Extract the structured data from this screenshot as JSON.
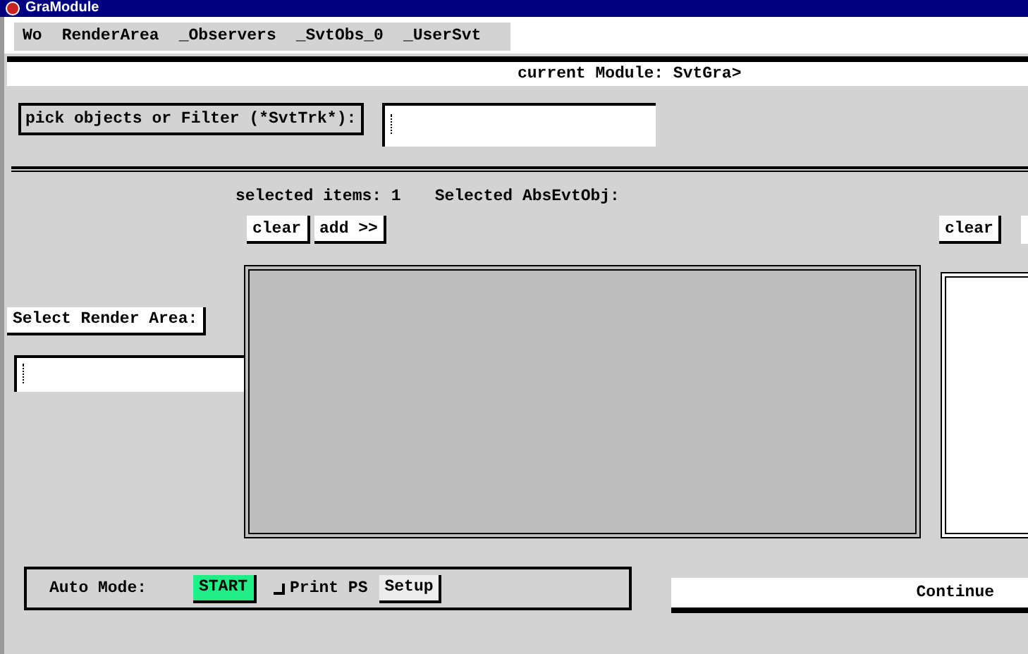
{
  "window": {
    "title": "GraModule"
  },
  "menu": [
    {
      "label": "Wo"
    },
    {
      "label": "RenderArea"
    },
    {
      "label": "_Observers"
    },
    {
      "label": "_SvtObs_0"
    },
    {
      "label": "_UserSvt"
    }
  ],
  "current_module": "current Module: SvtGra>",
  "filter": {
    "label": "pick objects or Filter (*SvtTrk*):"
  },
  "selection": {
    "count_label": "selected items: 1",
    "object_label": "Selected AbsEvtObj:",
    "buttons": [
      "clear",
      "add >>"
    ],
    "right_buttons": [
      "clear"
    ]
  },
  "render_area": {
    "label": "Select Render Area:"
  },
  "auto_mode": {
    "label": "Auto Mode:",
    "start": "START",
    "print_ps": {
      "label": "Print PS",
      "checked": false
    },
    "setup": "Setup"
  },
  "continue": "Continue"
}
